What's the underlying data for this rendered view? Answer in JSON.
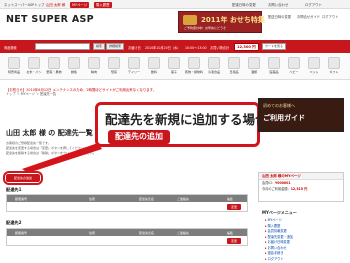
{
  "topbar": {
    "site": "ネットスーパーASPトップ",
    "greeting": "山田 太郎 様",
    "mypage_btn": "MYページ",
    "cart_btn": "購入履歴",
    "links": [
      "配達日時の変更",
      "お問い合わせ",
      "ログアウト"
    ]
  },
  "header": {
    "logo": "NET SUPER ASP",
    "promo_title": "2011年 おせち特集",
    "promo_sub": "ご予約受付中！お早めにどうぞ",
    "links": [
      "配送日時の変更",
      "お問合せガイド",
      "ログアウト"
    ]
  },
  "navbar": {
    "search_label": "商品検索",
    "search_placeholder": "",
    "search_btn": "検索",
    "detail_btn": "詳細検索",
    "delivery_label": "お届け日",
    "delivery_value": "2010年10月20日（水）",
    "time_value": "10:00～13:00",
    "cart_label": "お買い物合計",
    "cart_total": "12,300 円",
    "cart_btn": "カートを見る"
  },
  "categories": [
    "特売商品",
    "お米・パン",
    "野菜・果物",
    "鮮魚",
    "精肉",
    "惣菜",
    "デイリー",
    "飲料",
    "菓子",
    "乾物・調味料",
    "冷凍食品",
    "日用品",
    "酒類",
    "医薬品",
    "ベビー",
    "ペット",
    "ギフト"
  ],
  "notice": "【お知らせ】2010年6月12日 メンテナンスのため、2時間ほどサイトがご利用出来なくなります。",
  "breadcrumb": "トップ ＞ MYページ ＞ 配達先一覧",
  "page_title": "山田 太郎 様 の 配達先一覧",
  "desc_lines": [
    "お客様のご登録配達先一覧です。",
    "配達先を変更する場合は「変更」ボタンを押してください。",
    "配達先を削除する場合は「削除」ボタンをクリックしてください。"
  ],
  "callout": {
    "text": "配達先を新規に追加する場合は",
    "button": "配達先の追加"
  },
  "add_button": "配達先の追加",
  "address_blocks": [
    {
      "title": "配達先1",
      "headers": [
        "郵便番号",
        "住所",
        "配達先氏名",
        "ご連絡先",
        "編集"
      ],
      "edit": "変更"
    },
    {
      "title": "配達先2",
      "headers": [
        "郵便番号",
        "住所",
        "配達先氏名",
        "ご連絡先",
        "編集"
      ],
      "edit": "変更"
    }
  ],
  "sidebar": {
    "banner_top": "初めてのお客様へ",
    "banner_main": "ご利用ガイド",
    "mypage_title": "山田 太郎 様のMYページ",
    "user_id_label": "会員ID：",
    "user_id": "Y000001",
    "points_label": "今月のご利用金額：",
    "points": "12,315 円",
    "menu_title": "MYページメニュー",
    "menu_items": [
      "MYページ",
      "購入履歴",
      "会員情報変更",
      "配達先変更・追加",
      "お届け日時変更",
      "お問い合わせ",
      "退会手続き",
      "ログアウト"
    ]
  }
}
